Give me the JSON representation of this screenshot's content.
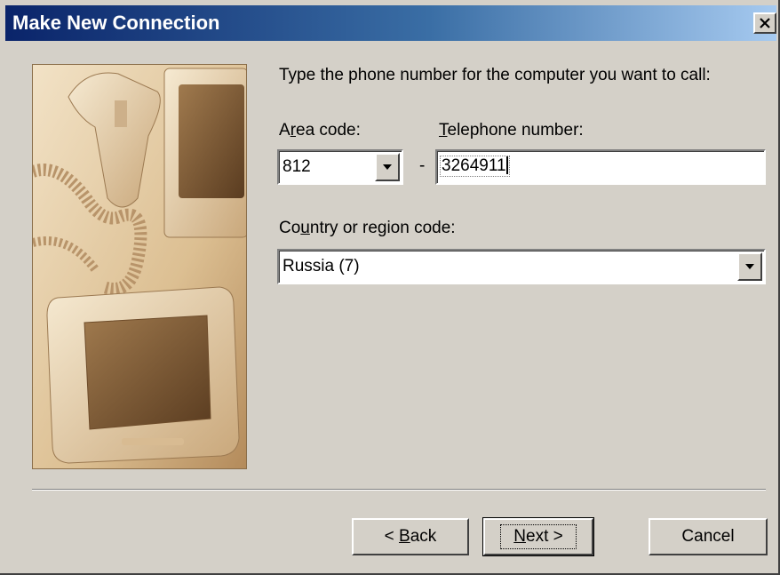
{
  "window": {
    "title": "Make New Connection",
    "close_icon": "close-icon"
  },
  "content": {
    "instruction": "Type the phone number for the computer you want to call:",
    "area_code": {
      "label_pre": "A",
      "label_accel": "r",
      "label_post": "ea code:",
      "value": "812"
    },
    "dash": "-",
    "telephone": {
      "label_accel": "T",
      "label_post": "elephone number:",
      "value": "3264911"
    },
    "country": {
      "label_pre": "Co",
      "label_accel": "u",
      "label_post": "ntry or region code:",
      "value": "Russia (7)"
    }
  },
  "buttons": {
    "back_pre": "< ",
    "back_accel": "B",
    "back_post": "ack",
    "next_accel": "N",
    "next_post": "ext >",
    "cancel": "Cancel"
  },
  "colors": {
    "titlebar_start": "#0a246a",
    "titlebar_end": "#a6caf0",
    "face": "#d4d0c8"
  }
}
